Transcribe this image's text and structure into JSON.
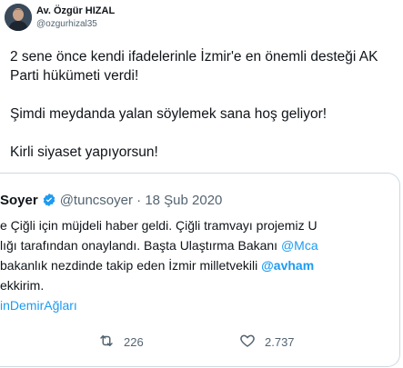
{
  "author": {
    "name": "Av. Özgür HIZAL",
    "handle": "@ozgurhizal35"
  },
  "tweet": {
    "line1": "2 sene önce kendi ifadelerinle İzmir'e en önemli desteği AK Parti hükümeti verdi!",
    "line2": "Şimdi meydanda yalan söylemek sana hoş geliyor!",
    "line3": "Kirli siyaset yapıyorsun!"
  },
  "quote": {
    "name": "Soyer",
    "handle": "@tuncsoyer",
    "separator": "·",
    "date": "18 Şub 2020",
    "lines": [
      "e Çiğli için müjdeli haber geldi. Çiğli tramvayı projemiz U",
      "lığı tarafından onaylandı. Başta Ulaştırma Bakanı ",
      " bakanlık nezdinde takip eden İzmir milletvekili ",
      "ekkirim.",
      "inDemirAğları"
    ],
    "mention1": "@Mca",
    "mention2": "@avham"
  },
  "actions": {
    "retweet_count": "226",
    "like_count": "2.737"
  },
  "icons": {
    "verified": "verified-badge-icon",
    "retweet": "retweet-icon",
    "like": "heart-icon"
  },
  "colors": {
    "accent": "#1d9bf0",
    "secondary_text": "#536471",
    "border": "#cfd9de"
  }
}
